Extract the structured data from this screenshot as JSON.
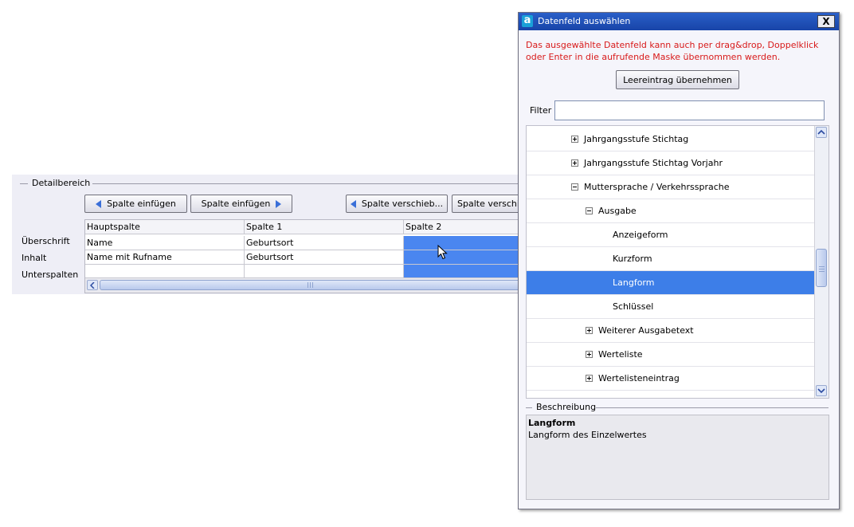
{
  "detail": {
    "legend": "Detailbereich",
    "buttons": {
      "insert_left": "Spalte einfügen",
      "insert_right": "Spalte einfügen",
      "move_left": "Spalte verschieb...",
      "move_right": "Spalte verschi"
    },
    "row_labels": [
      "Überschrift",
      "Inhalt",
      "Unterspalten"
    ],
    "columns": [
      "Hauptspalte",
      "Spalte 1",
      "Spalte 2"
    ],
    "rows": [
      [
        "Name",
        "Geburtsort",
        ""
      ],
      [
        "Name mit Rufname",
        "Geburtsort",
        ""
      ],
      [
        "",
        "",
        ""
      ]
    ],
    "selected_column": "Spalte 2"
  },
  "dialog": {
    "title": "Datenfeld auswählen",
    "close_label": "X",
    "app_icon": "a",
    "info": "Das ausgewählte Datenfeld kann auch per drag&drop, Doppelklick oder Enter in die aufrufende Maske übernommen werden.",
    "empty_entry_button": "Leereintrag übernehmen",
    "filter_label": "Filter",
    "filter_value": "",
    "tree": [
      {
        "label": "Jahrgangsstufe Stichtag",
        "expander": "plus"
      },
      {
        "label": "Jahrgangsstufe Stichtag Vorjahr",
        "expander": "plus"
      },
      {
        "label": "Muttersprache / Verkehrssprache",
        "expander": "minus"
      },
      {
        "label": "Ausgabe",
        "expander": "minus"
      },
      {
        "label": "Anzeigeform",
        "expander": "none"
      },
      {
        "label": "Kurzform",
        "expander": "none"
      },
      {
        "label": "Langform",
        "expander": "none",
        "selected": true
      },
      {
        "label": "Schlüssel",
        "expander": "none"
      },
      {
        "label": "Weiterer Ausgabetext",
        "expander": "plus"
      },
      {
        "label": "Werteliste",
        "expander": "plus"
      },
      {
        "label": "Wertelisteneintrag",
        "expander": "plus"
      }
    ],
    "description": {
      "legend": "Beschreibung",
      "title": "Langform",
      "text": "Langform des Einzelwertes"
    }
  },
  "colors": {
    "selection": "#3d7ee8",
    "info_text": "#d81a1a",
    "title_bar": "#2a5fc8"
  }
}
